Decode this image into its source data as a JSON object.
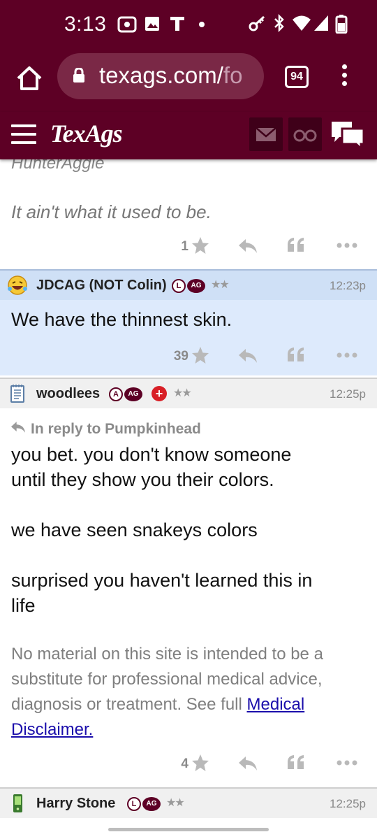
{
  "status_bar": {
    "time": "3:13",
    "icons": [
      "radio-icon",
      "image-icon",
      "t-icon",
      "dot-icon",
      "key-icon",
      "bluetooth-icon",
      "wifi-icon",
      "signal-icon",
      "battery-icon"
    ]
  },
  "browser": {
    "url_domain": "texags.com/",
    "url_rest": "fo",
    "tab_count": "94"
  },
  "site": {
    "logo": "TexAgs"
  },
  "colors": {
    "maroon": "#5d0025",
    "highlight_blue": "#ddeafc"
  },
  "posts": [
    {
      "cut_author": "HunterAggie",
      "quote": "It ain't what it used to be.",
      "likes": "1"
    },
    {
      "author": "JDCAG (NOT Colin)",
      "badge_letter": "L",
      "badge_ag": "AG",
      "stars": "★★",
      "time": "12:23p",
      "text": "We have the thinnest skin.",
      "likes": "39"
    },
    {
      "author": "woodlees",
      "badge_letter": "A",
      "badge_ag": "AG",
      "badge_plus": "+",
      "stars": "★★",
      "time": "12:25p",
      "reply_to": "In reply to Pumpkinhead",
      "lines": [
        "you bet. you don't know someone",
        "until they show you their colors.",
        "we have seen snakeys colors",
        "surprised you haven't learned this in",
        "life"
      ],
      "disclaimer_text": "No material on this site is intended to be a substitute for professional medical advice, diagnosis or treatment. See full ",
      "disclaimer_link": "Medical Disclaimer.",
      "likes": "4"
    },
    {
      "author": "Harry Stone",
      "badge_letter": "L",
      "badge_ag": "AG",
      "stars": "★★",
      "time": "12:25p"
    }
  ]
}
